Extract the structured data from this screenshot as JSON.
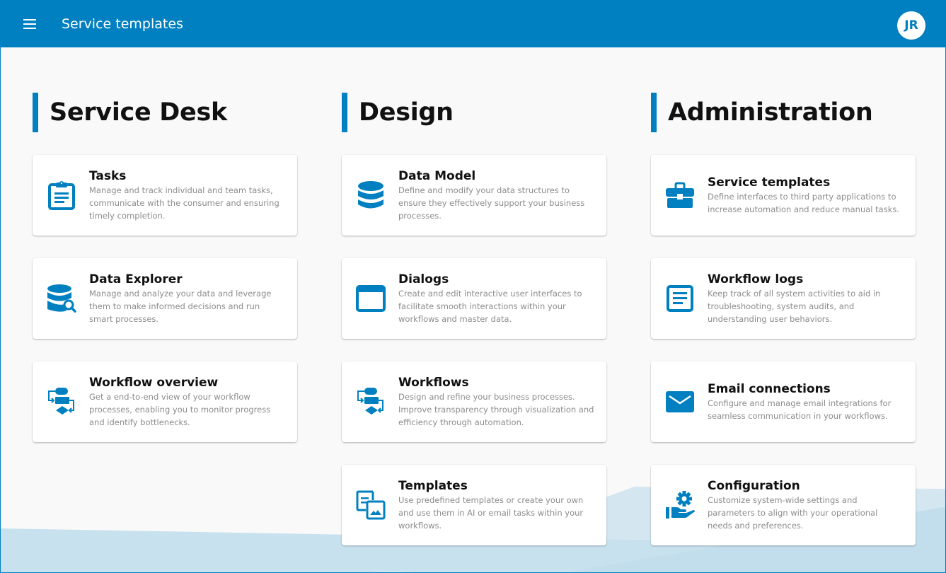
{
  "header": {
    "title": "Service templates",
    "menu_icon": "hamburger-menu-icon",
    "user_initials": "JR"
  },
  "colors": {
    "brand": "#0080c0",
    "background": "#f9f9f9",
    "card": "#ffffff",
    "title_text": "#111111",
    "desc_text": "#8c8c8c",
    "wave_light": "#d4e7f1",
    "wave_mid": "#c4dfec"
  },
  "sections": [
    {
      "title": "Service Desk",
      "cards": [
        {
          "icon": "clipboard-icon",
          "title": "Tasks",
          "description": "Manage and track individual and team tasks, communicate with the consumer and ensuring timely completion."
        },
        {
          "icon": "database-search-icon",
          "title": "Data Explorer",
          "description": "Manage and analyze your data and leverage them to make informed decisions and run smart processes."
        },
        {
          "icon": "workflow-diagram-icon",
          "title": "Workflow overview",
          "description": "Get a end-to-end view of your workflow processes, enabling you to monitor progress and identify bottlenecks."
        }
      ]
    },
    {
      "title": "Design",
      "cards": [
        {
          "icon": "database-icon",
          "title": "Data Model",
          "description": "Define and modify your data structures to ensure they effectively support your business processes."
        },
        {
          "icon": "window-icon",
          "title": "Dialogs",
          "description": "Create and edit interactive user interfaces to facilitate smooth interactions within your workflows and master data."
        },
        {
          "icon": "workflow-diagram-icon",
          "title": "Workflows",
          "description": "Design and refine your business processes. Improve transparency through visualization and efficiency through automation."
        },
        {
          "icon": "templates-icon",
          "title": "Templates",
          "description": "Use predefined templates or create your own and use them in AI or email tasks within your workflows."
        }
      ]
    },
    {
      "title": "Administration",
      "cards": [
        {
          "icon": "briefcase-icon",
          "title": "Service templates",
          "description": "Define interfaces to third party applications to increase automation and reduce manual tasks."
        },
        {
          "icon": "document-lines-icon",
          "title": "Workflow logs",
          "description": "Keep track of all system activities to aid in troubleshooting, system audits, and understanding user behaviors."
        },
        {
          "icon": "envelope-icon",
          "title": "Email connections",
          "description": "Configure and manage email integrations for seamless communication in your workflows."
        },
        {
          "icon": "hand-gear-icon",
          "title": "Configuration",
          "description": "Customize system-wide settings and parameters to align with your operational needs and preferences."
        }
      ]
    }
  ]
}
